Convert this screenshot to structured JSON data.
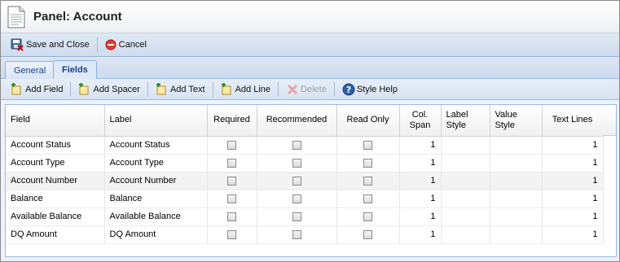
{
  "window": {
    "title": "Panel: Account"
  },
  "actions": {
    "save_close": "Save and Close",
    "cancel": "Cancel"
  },
  "tabs": [
    {
      "label": "General"
    },
    {
      "label": "Fields"
    }
  ],
  "grid_toolbar": {
    "add_field": "Add Field",
    "add_spacer": "Add Spacer",
    "add_text": "Add Text",
    "add_line": "Add Line",
    "delete": "Delete",
    "style_help": "Style Help"
  },
  "grid": {
    "columns": [
      "Field",
      "Label",
      "Required",
      "Recommended",
      "Read Only",
      "Col. Span",
      "Label Style",
      "Value Style",
      "Text Lines"
    ],
    "rows": [
      {
        "field": "Account Status",
        "label": "Account Status",
        "col_span": "1",
        "text_lines": "1"
      },
      {
        "field": "Account Type",
        "label": "Account Type",
        "col_span": "1",
        "text_lines": "1"
      },
      {
        "field": "Account Number",
        "label": "Account Number",
        "col_span": "1",
        "text_lines": "1"
      },
      {
        "field": "Balance",
        "label": "Balance",
        "col_span": "1",
        "text_lines": "1"
      },
      {
        "field": "Available Balance",
        "label": "Available Balance",
        "col_span": "1",
        "text_lines": "1"
      },
      {
        "field": "DQ Amount",
        "label": "DQ Amount",
        "col_span": "1",
        "text_lines": "1"
      }
    ]
  }
}
